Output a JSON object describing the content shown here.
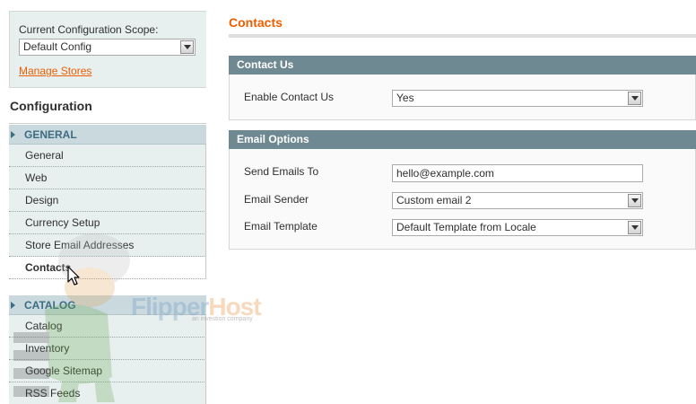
{
  "sidebar": {
    "scope": {
      "label": "Current Configuration Scope:",
      "selected": "Default Config",
      "manage_link": "Manage Stores"
    },
    "config_title": "Configuration",
    "groups": [
      {
        "label": "GENERAL",
        "items": [
          {
            "label": "General"
          },
          {
            "label": "Web"
          },
          {
            "label": "Design"
          },
          {
            "label": "Currency Setup"
          },
          {
            "label": "Store Email Addresses"
          },
          {
            "label": "Contacts",
            "active": true
          }
        ]
      },
      {
        "label": "CATALOG",
        "items": [
          {
            "label": "Catalog"
          },
          {
            "label": "Inventory"
          },
          {
            "label": "Google Sitemap"
          },
          {
            "label": "RSS Feeds"
          }
        ]
      }
    ]
  },
  "main": {
    "title": "Contacts",
    "contact_us": {
      "header": "Contact Us",
      "enable_label": "Enable Contact Us",
      "enable_value": "Yes"
    },
    "email_options": {
      "header": "Email Options",
      "send_to_label": "Send Emails To",
      "send_to_value": "hello@example.com",
      "sender_label": "Email Sender",
      "sender_value": "Custom email 2",
      "template_label": "Email Template",
      "template_value": "Default Template from Locale"
    }
  },
  "watermark": {
    "brand_part1": "Flipper",
    "brand_part2": "Host",
    "tagline": "an investion company"
  },
  "colors": {
    "accent_orange": "#eb5e00",
    "fieldset_header": "#6f8992",
    "sidebar_bg": "#e7efef",
    "group_header_bg": "#c9d9de",
    "group_header_text": "#3d6c83"
  },
  "icons": {
    "select_arrow": "chevron-down-icon",
    "group_toggle": "triangle-right-icon",
    "cursor": "mouse-pointer-icon"
  }
}
